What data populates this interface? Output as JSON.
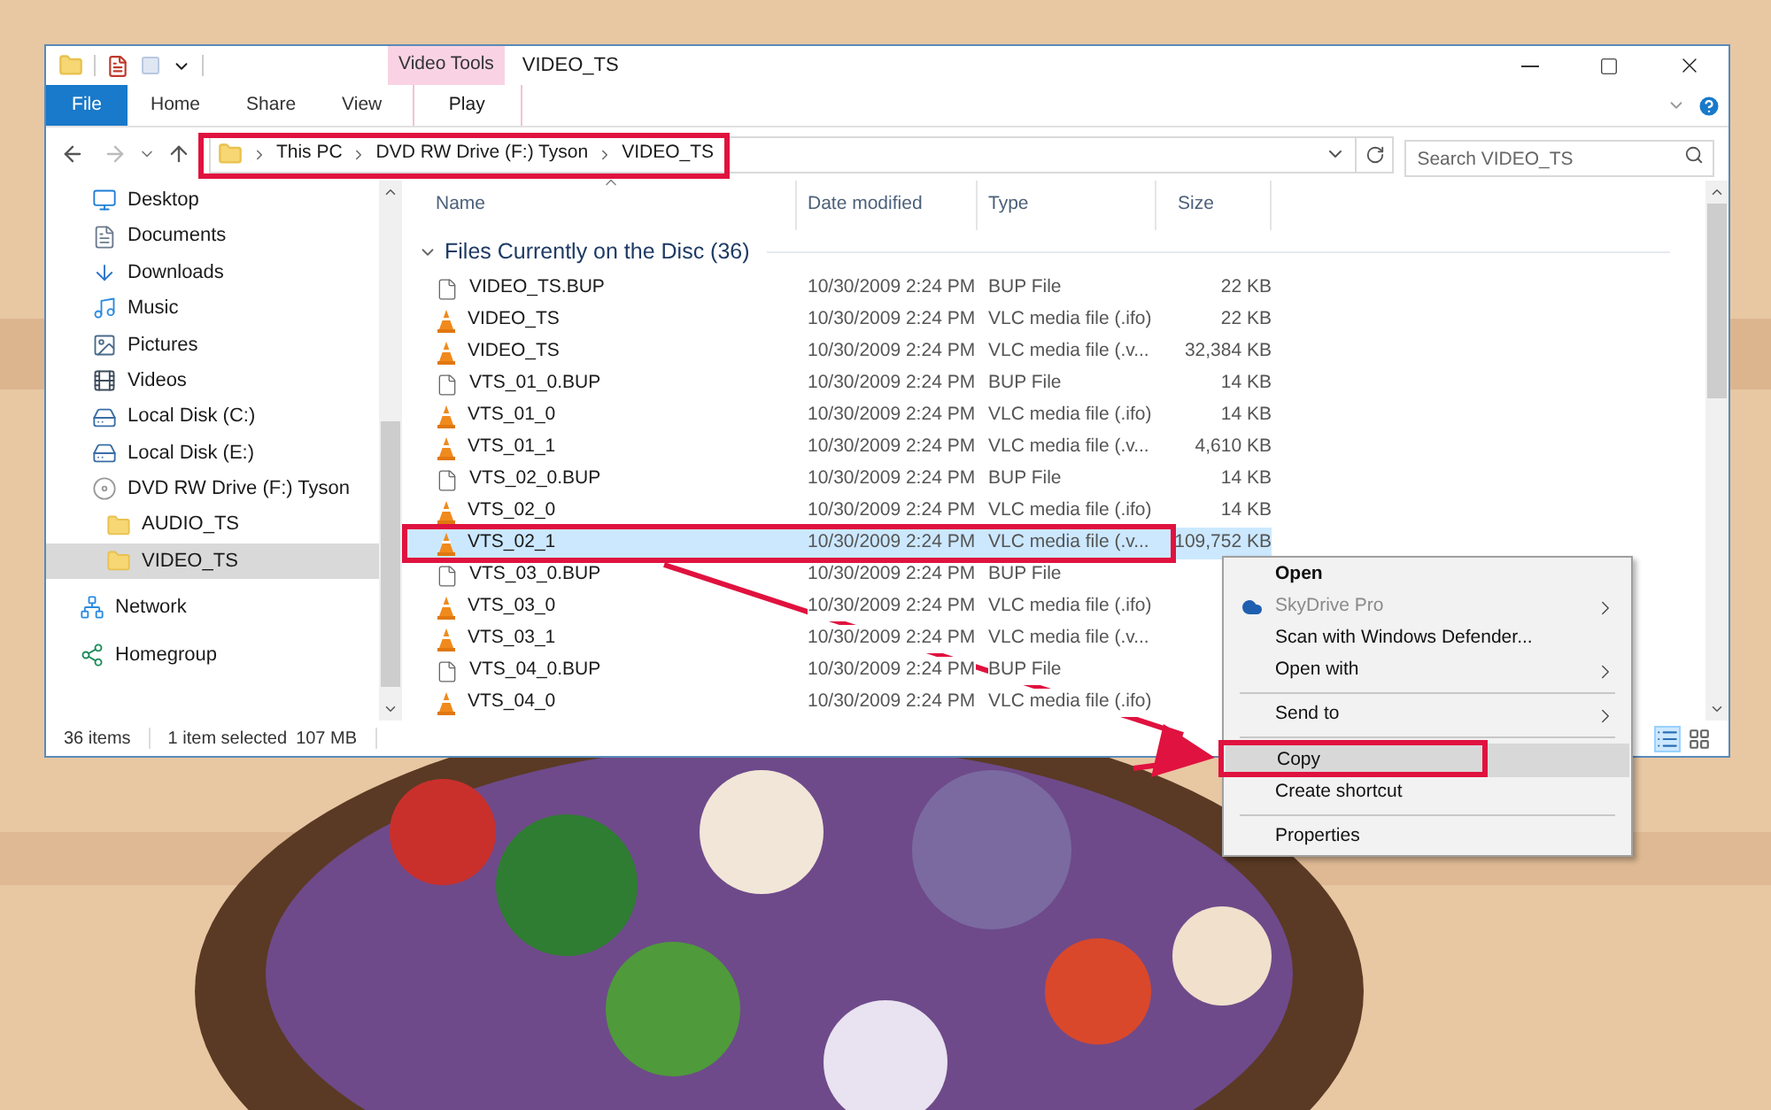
{
  "window": {
    "title": "VIDEO_TS",
    "contextual_group": "Video Tools"
  },
  "ribbon_tabs": [
    {
      "label": "File",
      "kind": "file",
      "selected": false
    },
    {
      "label": "Home",
      "kind": "plain",
      "selected": false
    },
    {
      "label": "Share",
      "kind": "plain",
      "selected": false
    },
    {
      "label": "View",
      "kind": "plain",
      "selected": false
    },
    {
      "label": "Play",
      "kind": "contextual",
      "selected": false
    }
  ],
  "address_bar": {
    "path": [
      "This PC",
      "DVD RW Drive (F:) Tyson",
      "VIDEO_TS"
    ]
  },
  "search": {
    "placeholder": "Search VIDEO_TS"
  },
  "sidebar": {
    "items": [
      {
        "label": "Desktop",
        "kind": "desktop",
        "selected": false
      },
      {
        "label": "Documents",
        "kind": "documents",
        "selected": false
      },
      {
        "label": "Downloads",
        "kind": "downloads",
        "selected": false
      },
      {
        "label": "Music",
        "kind": "music",
        "selected": false
      },
      {
        "label": "Pictures",
        "kind": "pictures",
        "selected": false
      },
      {
        "label": "Videos",
        "kind": "videos",
        "selected": false
      },
      {
        "label": "Local Disk (C:)",
        "kind": "drive",
        "selected": false
      },
      {
        "label": "Local Disk (E:)",
        "kind": "drive",
        "selected": false
      },
      {
        "label": "DVD RW Drive (F:) Tyson",
        "kind": "dvd",
        "selected": false,
        "children": [
          {
            "label": "AUDIO_TS",
            "kind": "folder",
            "selected": false
          },
          {
            "label": "VIDEO_TS",
            "kind": "folder",
            "selected": true
          }
        ]
      },
      {
        "label": "Network",
        "kind": "network",
        "selected": false
      },
      {
        "label": "Homegroup",
        "kind": "homegroup",
        "selected": false
      }
    ]
  },
  "columns": [
    {
      "label": "Name",
      "sorted": true
    },
    {
      "label": "Date modified",
      "sorted": false
    },
    {
      "label": "Type",
      "sorted": false
    },
    {
      "label": "Size",
      "sorted": false
    }
  ],
  "group": {
    "title": "Files Currently on the Disc (36)",
    "expanded": true
  },
  "rows": [
    {
      "name": "VIDEO_TS.BUP",
      "date": "10/30/2009 2:24 PM",
      "type": "BUP File",
      "size": "22 KB",
      "kind": "file",
      "selected": false
    },
    {
      "name": "VIDEO_TS",
      "date": "10/30/2009 2:24 PM",
      "type": "VLC media file (.ifo)",
      "size": "22 KB",
      "kind": "vlc",
      "selected": false
    },
    {
      "name": "VIDEO_TS",
      "date": "10/30/2009 2:24 PM",
      "type": "VLC media file (.v...",
      "size": "32,384 KB",
      "kind": "vlc",
      "selected": false
    },
    {
      "name": "VTS_01_0.BUP",
      "date": "10/30/2009 2:24 PM",
      "type": "BUP File",
      "size": "14 KB",
      "kind": "file",
      "selected": false
    },
    {
      "name": "VTS_01_0",
      "date": "10/30/2009 2:24 PM",
      "type": "VLC media file (.ifo)",
      "size": "14 KB",
      "kind": "vlc",
      "selected": false
    },
    {
      "name": "VTS_01_1",
      "date": "10/30/2009 2:24 PM",
      "type": "VLC media file (.v...",
      "size": "4,610 KB",
      "kind": "vlc",
      "selected": false
    },
    {
      "name": "VTS_02_0.BUP",
      "date": "10/30/2009 2:24 PM",
      "type": "BUP File",
      "size": "14 KB",
      "kind": "file",
      "selected": false
    },
    {
      "name": "VTS_02_0",
      "date": "10/30/2009 2:24 PM",
      "type": "VLC media file (.ifo)",
      "size": "14 KB",
      "kind": "vlc",
      "selected": false
    },
    {
      "name": "VTS_02_1",
      "date": "10/30/2009 2:24 PM",
      "type": "VLC media file (.v...",
      "size": "109,752 KB",
      "kind": "vlc",
      "selected": true
    },
    {
      "name": "VTS_03_0.BUP",
      "date": "10/30/2009 2:24 PM",
      "type": "BUP File",
      "kind": "file",
      "selected": false
    },
    {
      "name": "VTS_03_0",
      "date": "10/30/2009 2:24 PM",
      "type": "VLC media file (.ifo)",
      "kind": "vlc",
      "selected": false
    },
    {
      "name": "VTS_03_1",
      "date": "10/30/2009 2:24 PM",
      "type": "VLC media file (.v...",
      "kind": "vlc",
      "selected": false
    },
    {
      "name": "VTS_04_0.BUP",
      "date": "10/30/2009 2:24 PM",
      "type": "BUP File",
      "kind": "file",
      "selected": false
    },
    {
      "name": "VTS_04_0",
      "date": "10/30/2009 2:24 PM",
      "type": "VLC media file (.ifo)",
      "kind": "vlc",
      "selected": false
    }
  ],
  "status_bar": {
    "item_count": "36 items",
    "selection": "1 item selected",
    "selection_size": "107 MB"
  },
  "context_menu": {
    "groups": [
      {
        "items": [
          {
            "label": "Open",
            "bold": true,
            "disabled": false,
            "submenu": false,
            "highlighted": false
          },
          {
            "label": "SkyDrive Pro",
            "bold": false,
            "disabled": true,
            "submenu": true,
            "highlighted": false,
            "kind": "cloud"
          },
          {
            "label": "Scan with Windows Defender...",
            "bold": false,
            "disabled": false,
            "submenu": false,
            "highlighted": false
          },
          {
            "label": "Open with",
            "bold": false,
            "disabled": false,
            "submenu": true,
            "highlighted": false
          }
        ]
      },
      {
        "items": [
          {
            "label": "Send to",
            "bold": false,
            "disabled": false,
            "submenu": true,
            "highlighted": false
          }
        ]
      },
      {
        "items": [
          {
            "label": "Copy",
            "bold": false,
            "disabled": false,
            "submenu": false,
            "highlighted": true
          },
          {
            "label": "Create shortcut",
            "bold": false,
            "disabled": false,
            "submenu": false,
            "highlighted": false
          }
        ]
      },
      {
        "items": [
          {
            "label": "Properties",
            "bold": false,
            "disabled": false,
            "submenu": false,
            "highlighted": false
          }
        ]
      }
    ]
  }
}
